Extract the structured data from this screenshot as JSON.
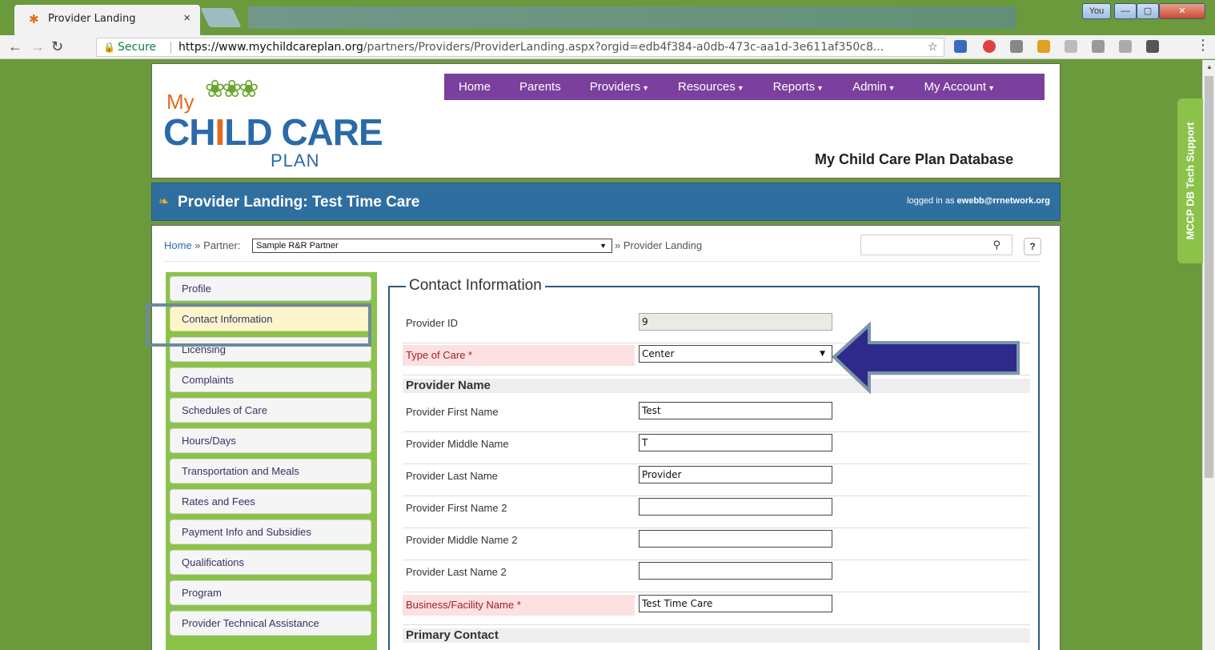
{
  "browser": {
    "tab_title": "Provider Landing",
    "secure_label": "Secure",
    "url_host": "https://www.mychildcareplan.org",
    "url_path": "/partners/Providers/ProviderLanding.aspx?orgid=edb4f384-a0db-473c-aa1d-3e611af350c8...",
    "profile_label": "You"
  },
  "header": {
    "logo_my": "My",
    "logo_ch": "CH",
    "logo_i": "I",
    "logo_rest": "LD CARE",
    "logo_plan": "PLAN",
    "db_title": "My Child Care Plan Database",
    "nav": [
      {
        "label": "Home"
      },
      {
        "label": "Parents"
      },
      {
        "label": "Providers"
      },
      {
        "label": "Resources"
      },
      {
        "label": "Reports"
      },
      {
        "label": "Admin"
      },
      {
        "label": "My Account"
      }
    ]
  },
  "titlebar": {
    "title": "Provider Landing: Test Time Care",
    "logged_prefix": "logged in as",
    "logged_user": "ewebb@rrnetwork.org"
  },
  "breadcrumb": {
    "home": "Home",
    "partner_label": "Partner:",
    "partner_value": "Sample R&R Partner",
    "current": "» Provider Landing"
  },
  "support_tab": "MCCP DB Tech Support",
  "sidenav": [
    {
      "label": "Profile"
    },
    {
      "label": "Contact Information"
    },
    {
      "label": "Licensing"
    },
    {
      "label": "Complaints"
    },
    {
      "label": "Schedules of Care"
    },
    {
      "label": "Hours/Days"
    },
    {
      "label": "Transportation and Meals"
    },
    {
      "label": "Rates and Fees"
    },
    {
      "label": "Payment Info and Subsidies"
    },
    {
      "label": "Qualifications"
    },
    {
      "label": "Program"
    },
    {
      "label": "Provider Technical Assistance"
    }
  ],
  "form": {
    "legend": "Contact Information",
    "provider_id": {
      "label": "Provider ID",
      "value": "9"
    },
    "type_of_care": {
      "label": "Type of Care *",
      "value": "Center"
    },
    "section_provider_name": "Provider Name",
    "first_name": {
      "label": "Provider First Name",
      "value": "Test"
    },
    "middle_name": {
      "label": "Provider Middle Name",
      "value": "T"
    },
    "last_name": {
      "label": "Provider Last Name",
      "value": "Provider"
    },
    "first_name2": {
      "label": "Provider First Name 2",
      "value": ""
    },
    "middle_name2": {
      "label": "Provider Middle Name 2",
      "value": ""
    },
    "last_name2": {
      "label": "Provider Last Name 2",
      "value": ""
    },
    "business_name": {
      "label": "Business/Facility Name *",
      "value": "Test Time Care"
    },
    "section_primary_contact": "Primary Contact"
  },
  "colors": {
    "nav_purple": "#7b3f9e",
    "title_blue": "#2f6f9f",
    "side_green": "#8bc34a",
    "arrow_navy": "#2e2a8c"
  }
}
